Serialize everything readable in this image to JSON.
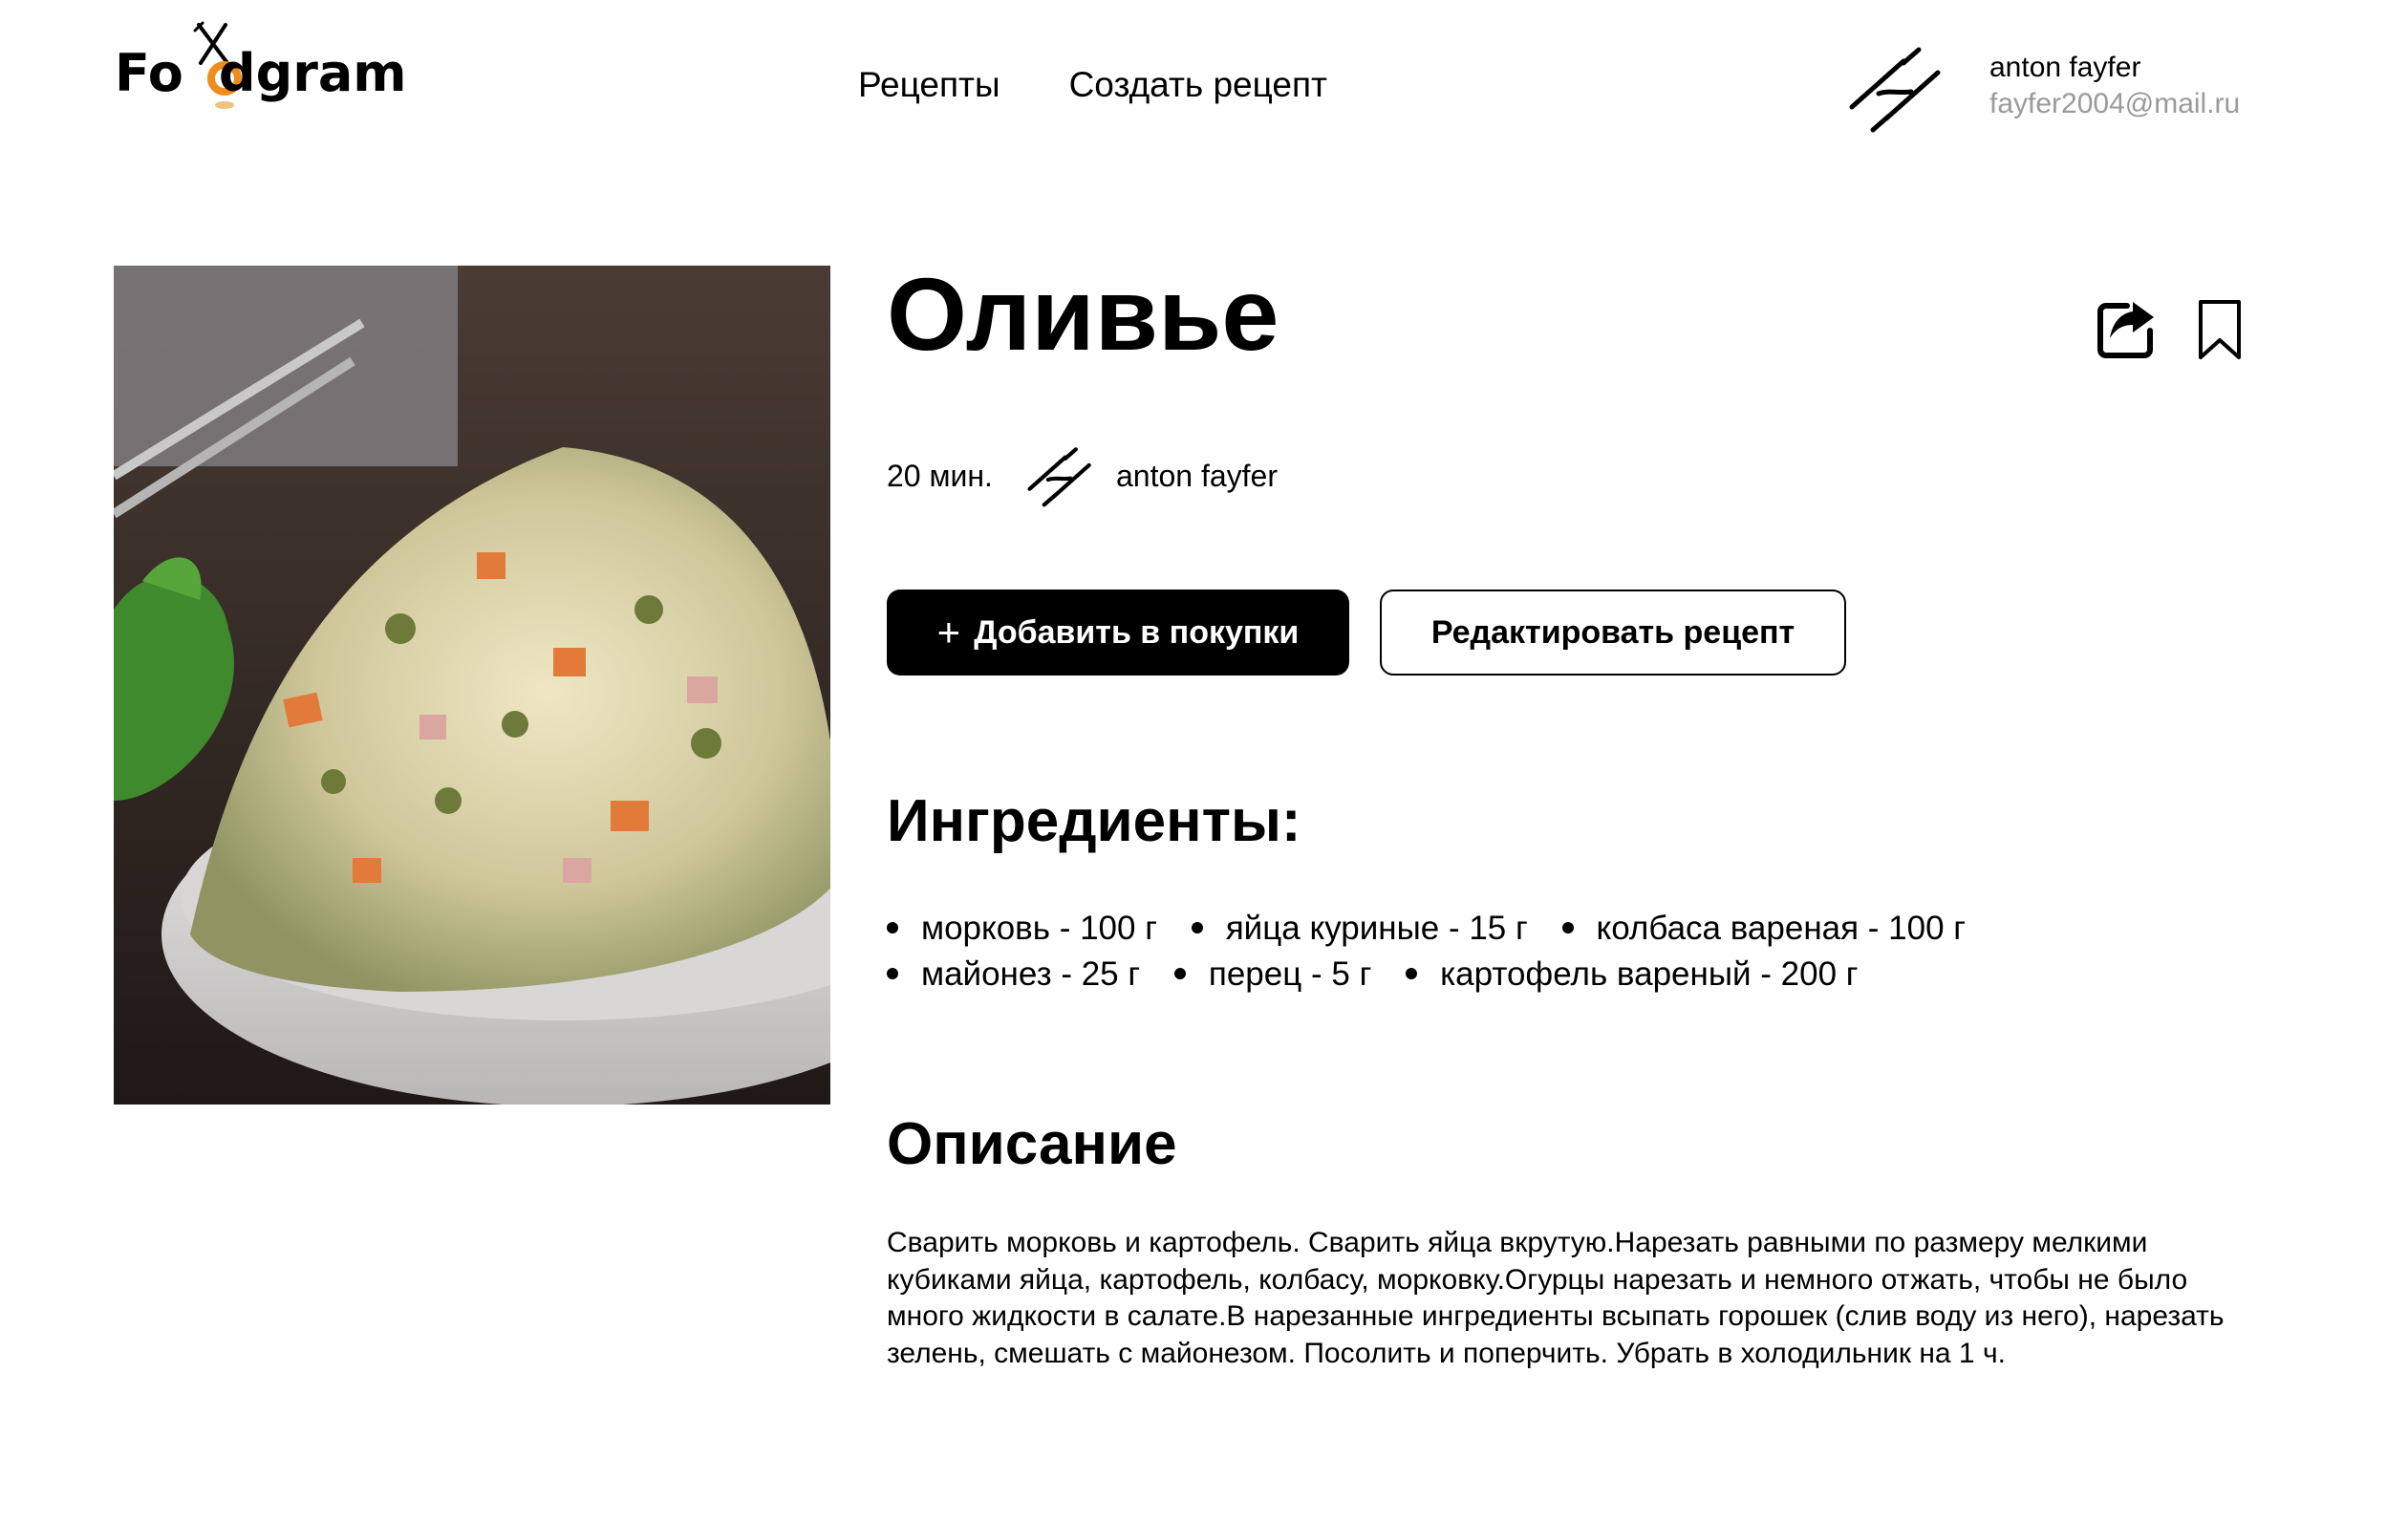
{
  "header": {
    "logo": "Foodgram",
    "nav": [
      {
        "label": "Рецепты"
      },
      {
        "label": "Создать рецепт"
      }
    ],
    "user": {
      "name": "anton fayfer",
      "email": "fayfer2004@mail.ru",
      "avatar_icon": "chain-link-icon"
    }
  },
  "recipe": {
    "title": "Оливье",
    "image_icon": "olivier-salad-photo",
    "cook_time": "20 мин.",
    "author": "anton fayfer",
    "actions": {
      "share_icon": "share-icon",
      "favorite_icon": "bookmark-icon",
      "add_to_cart_label": "Добавить в покупки",
      "edit_label": "Редактировать рецепт"
    },
    "ingredients_title": "Ингредиенты:",
    "ingredients": [
      {
        "text": "морковь - 100 г"
      },
      {
        "text": "яйца куриные - 15 г"
      },
      {
        "text": "колбаса вареная - 100 г"
      },
      {
        "text": "майонез - 25 г"
      },
      {
        "text": "перец - 5 г"
      },
      {
        "text": "картофель вареный - 200 г"
      }
    ],
    "description_title": "Описание",
    "description": "Сварить морковь и картофель. Сварить яйца вкрутую.Нарезать равными по размеру мелкими кубиками яйца, картофель, колбасу, морковку.Огурцы нарезать и немного отжать, чтобы не было много жидкости в салате.В нарезанные ингредиенты всыпать горошек (слив воду из него), нарезать зелень, смешать с майонезом. Посолить и поперчить. Убрать в холодильник на 1 ч."
  },
  "colors": {
    "accent": "#f08c1c",
    "primary": "#000000",
    "muted": "#9a9a9a"
  }
}
